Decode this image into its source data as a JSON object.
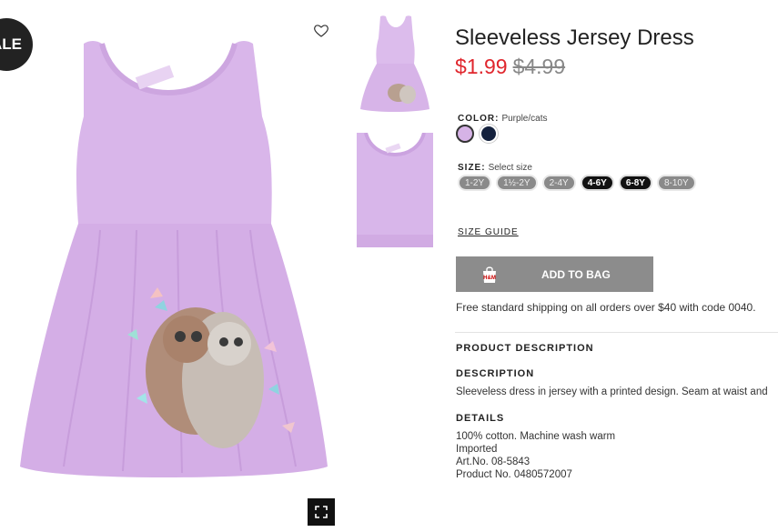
{
  "badge": {
    "sale": "ALE"
  },
  "product": {
    "title": "Sleeveless Jersey Dress",
    "price_now": "$1.99",
    "price_was": "$4.99",
    "color_label": "COLOR:",
    "color_value": "Purple/cats",
    "colors": [
      {
        "name": "Purple/cats",
        "hex": "#d6b3e6",
        "selected": true
      },
      {
        "name": "Dark blue",
        "hex": "#14213d",
        "selected": false
      }
    ],
    "size_label": "SIZE:",
    "size_value": "Select size",
    "sizes": [
      {
        "label": "1-2Y",
        "available": false
      },
      {
        "label": "1½-2Y",
        "available": false
      },
      {
        "label": "2-4Y",
        "available": false
      },
      {
        "label": "4-6Y",
        "available": true
      },
      {
        "label": "6-8Y",
        "available": true
      },
      {
        "label": "8-10Y",
        "available": false
      }
    ],
    "size_guide": "SIZE GUIDE",
    "add_to_bag": "ADD TO BAG",
    "shipping": "Free standard shipping on all orders over $40 with code 0040."
  },
  "description": {
    "section_title": "PRODUCT DESCRIPTION",
    "desc_title": "DESCRIPTION",
    "desc_text": "Sleeveless dress in jersey with a printed design. Seam at waist and",
    "details_title": "DETAILS",
    "details": [
      "100% cotton. Machine wash warm",
      "Imported",
      "Art.No. 08-5843",
      "Product No. 0480572007"
    ]
  },
  "icons": {
    "heart": "heart-icon",
    "fullscreen": "expand-icon",
    "bag": "shopping-bag-icon"
  },
  "colors": {
    "price_sale": "#e0262d",
    "button": "#8c8c8c",
    "dress": "#d6b3e6"
  }
}
